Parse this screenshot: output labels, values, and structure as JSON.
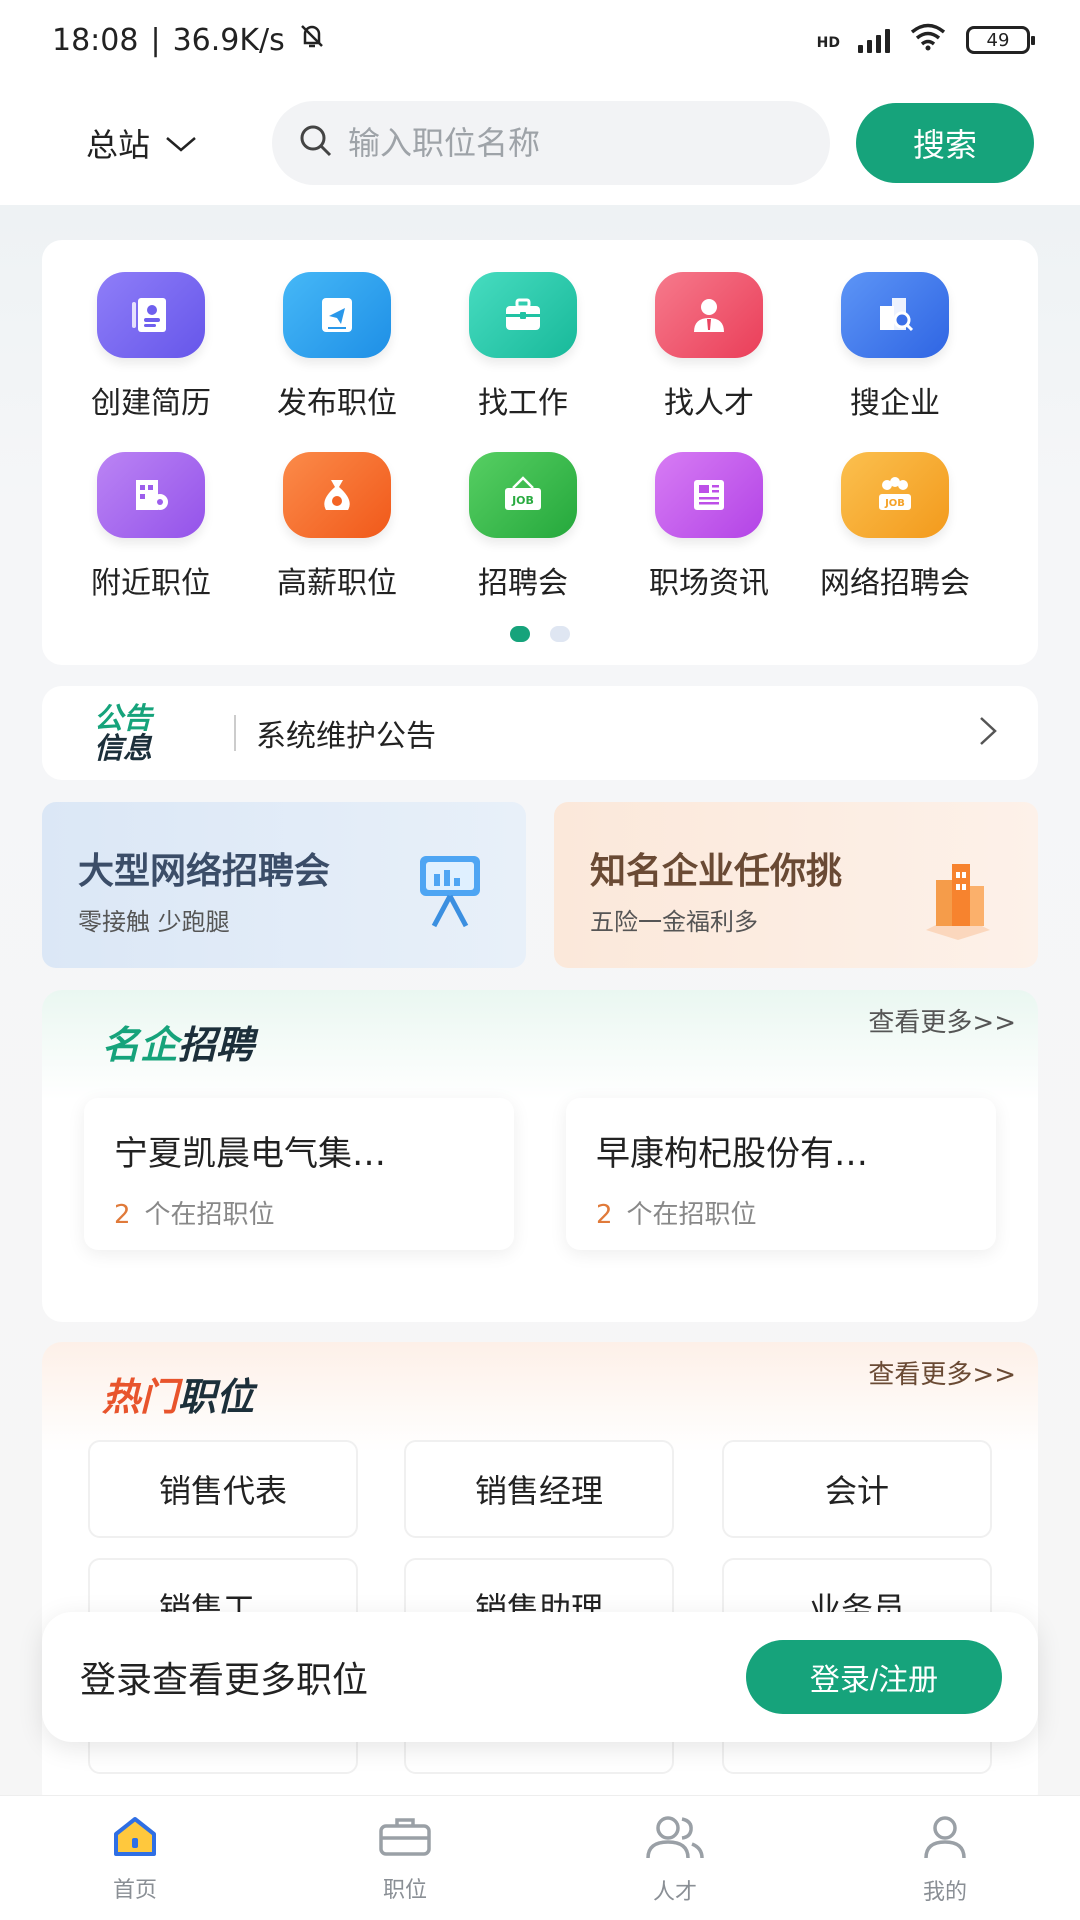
{
  "status_bar": {
    "time": "18:08",
    "speed": "36.9K/s",
    "network": "HD",
    "battery": "49"
  },
  "header": {
    "site": "总站",
    "search_placeholder": "输入职位名称",
    "search_button": "搜索"
  },
  "quick_menu": [
    {
      "label": "创建简历",
      "icon": "resume-icon",
      "color": "#7b6cf3"
    },
    {
      "label": "发布职位",
      "icon": "publish-icon",
      "color": "#2ea2f2"
    },
    {
      "label": "找工作",
      "icon": "briefcase-icon",
      "color": "#22c9a8"
    },
    {
      "label": "找人才",
      "icon": "person-icon",
      "color": "#f2576e"
    },
    {
      "label": "搜企业",
      "icon": "company-search-icon",
      "color": "#3f7bf0"
    },
    {
      "label": "附近职位",
      "icon": "nearby-icon",
      "color": "#a565ef"
    },
    {
      "label": "高薪职位",
      "icon": "money-bag-icon",
      "color": "#f86b2a"
    },
    {
      "label": "招聘会",
      "icon": "job-fair-icon",
      "color": "#34b94b"
    },
    {
      "label": "职场资讯",
      "icon": "news-icon",
      "color": "#c458ec"
    },
    {
      "label": "网络招聘会",
      "icon": "online-fair-icon",
      "color": "#f5a628"
    }
  ],
  "notice": {
    "logo_line1": "公告",
    "logo_line2": "信息",
    "text": "系统维护公告"
  },
  "banners": [
    {
      "title": "大型网络招聘会",
      "subtitle": "零接触 少跑腿"
    },
    {
      "title": "知名企业任你挑",
      "subtitle": "五险一金福利多"
    }
  ],
  "famous_companies": {
    "title_part1": "名企",
    "title_part2": "招聘",
    "more": "查看更多>>",
    "companies": [
      {
        "name": "宁夏凯晨电气集…",
        "count": "2",
        "count_label": "个在招职位"
      },
      {
        "name": "早康枸杞股份有…",
        "count": "2",
        "count_label": "个在招职位"
      }
    ]
  },
  "hot_jobs": {
    "title_part1": "热门",
    "title_part2": "职位",
    "more": "查看更多>>",
    "jobs": [
      "销售代表",
      "销售经理",
      "会计",
      "销售工…",
      "销售助理",
      "业务员"
    ]
  },
  "login_prompt": {
    "text": "登录查看更多职位",
    "button": "登录/注册"
  },
  "tabs": [
    {
      "label": "首页",
      "icon": "home-icon"
    },
    {
      "label": "职位",
      "icon": "briefcase-icon"
    },
    {
      "label": "人才",
      "icon": "people-icon"
    },
    {
      "label": "我的",
      "icon": "user-icon"
    }
  ]
}
